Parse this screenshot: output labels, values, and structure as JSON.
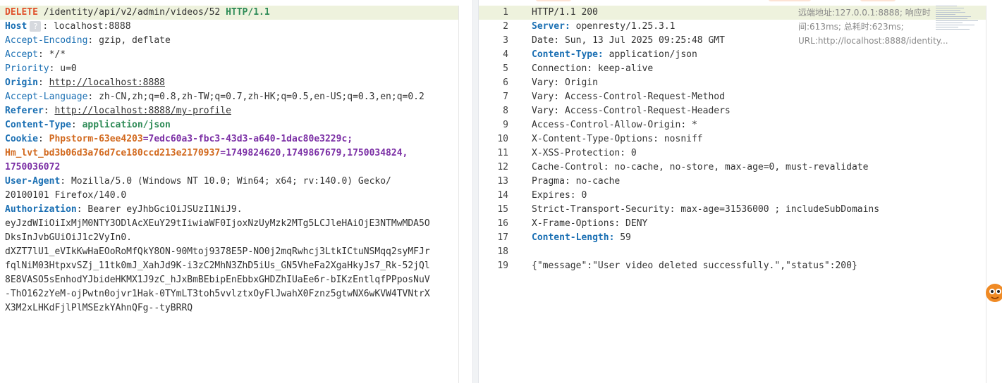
{
  "request": {
    "method": "DELETE",
    "path": "/identity/api/v2/admin/videos/52",
    "protocol": "HTTP/1.1",
    "headers": {
      "host_name": "Host",
      "host_badge": "?",
      "host_value": "localhost:8888",
      "accept_encoding_name": "Accept-Encoding",
      "accept_encoding_value": "gzip, deflate",
      "accept_name": "Accept",
      "accept_value": "*/*",
      "priority_name": "Priority",
      "priority_value": "u=0",
      "origin_name": "Origin",
      "origin_value": "http://localhost:8888",
      "accept_language_name": "Accept-Language",
      "accept_language_value": "zh-CN,zh;q=0.8,zh-TW;q=0.7,zh-HK;q=0.5,en-US;q=0.3,en;q=0.2",
      "referer_name": "Referer",
      "referer_value": "http://localhost:8888/my-profile",
      "content_type_name": "Content-Type",
      "content_type_value": "application/json",
      "cookie_name": "Cookie",
      "cookie1_name": "Phpstorm-63ee4203",
      "cookie1_value": "=7edc60a3-fbc3-43d3-a640-1dac80e3229c;",
      "cookie2_name": "Hm_lvt_bd3b06d3a76d7ce180ccd213e2170937",
      "cookie2_value": "=1749824620,1749867679,1750034824,",
      "cookie2_value_cont": "1750036072",
      "user_agent_name": "User-Agent",
      "user_agent_value_1": "Mozilla/5.0 (Windows NT 10.0; Win64; x64; rv:140.0) Gecko/",
      "user_agent_value_2": "20100101 Firefox/140.0",
      "authorization_name": "Authorization",
      "authorization_value_1": "Bearer eyJhbGciOiJSUzI1NiJ9.",
      "authorization_value_2": "eyJzdWIiOiIxMjM0NTY3ODlAcXEuY29tIiwiaWF0IjoxNzUyMzk2MTg5LCJleHAiOjE3NTMwMDA5O",
      "authorization_value_3": "DksInJvbGUiOiJ1c2VyIn0.",
      "authorization_value_4": "dXZT7lU1_eVIkKwHaEOoRoMfQkY8ON-90Mtoj9378E5P-NO0j2mqRwhcj3LtkICtuNSMqq2syMFJr",
      "authorization_value_5": "fqlNiM03HtpxvSZj_11tk0mJ_XahJd9K-i3zC2MhN3ZhD5iUs_GN5VheFa2XgaHkyJs7_Rk-52jQl",
      "authorization_value_6": "8E8VASO5sEnhodYJbideHKMX1J9zC_hJxBmBEbipEnEbbxGHDZhIUaEe6r-bIKzEntlqfPPposNuV",
      "authorization_value_7": "-ThO162zYeM-ojPwtn0ojvr1Hak-0TYmLT3toh5vvlztxOyFlJwahX0Fznz5gtwNX6wKVW4TVNtrX",
      "authorization_value_8": "X3M2xLHKdFjlPlMSEzkYAhnQFg--tyBRRQ"
    }
  },
  "response": {
    "line_numbers": [
      "1",
      "2",
      "3",
      "4",
      "5",
      "6",
      "7",
      "8",
      "9",
      "10",
      "11",
      "12",
      "13",
      "14",
      "15",
      "16",
      "17",
      "18",
      "19"
    ],
    "status_line": "HTTP/1.1 200",
    "server_name": "Server:",
    "server_value": "openresty/1.25.3.1",
    "date": "Date: Sun, 13 Jul 2025 09:25:48 GMT",
    "content_type_name": "Content-Type:",
    "content_type_value": "application/json",
    "connection": "Connection: keep-alive",
    "vary1": "Vary: Origin",
    "vary2": "Vary: Access-Control-Request-Method",
    "vary3": "Vary: Access-Control-Request-Headers",
    "acao": "Access-Control-Allow-Origin: *",
    "xcto": "X-Content-Type-Options: nosniff",
    "xxss": "X-XSS-Protection: 0",
    "cache_control": "Cache-Control: no-cache, no-store, max-age=0, must-revalidate",
    "pragma": "Pragma: no-cache",
    "expires": "Expires: 0",
    "hsts": "Strict-Transport-Security: max-age=31536000 ; includeSubDomains",
    "xfo": "X-Frame-Options: DENY",
    "content_length_name": "Content-Length:",
    "content_length_value": "59",
    "body": "{\"message\":\"User video deleted successfully.\",\"status\":200}"
  },
  "remote_info": "远端地址:127.0.0.1:8888; 响应时间:613ms; 总耗时:623ms; URL:http://localhost:8888/identity..."
}
